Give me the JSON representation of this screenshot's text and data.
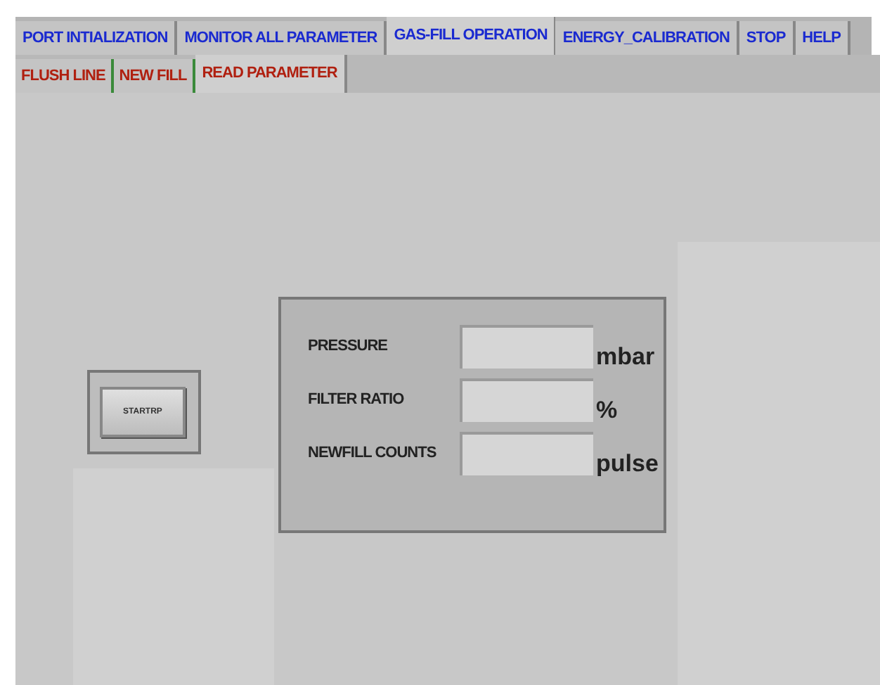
{
  "tabs": [
    {
      "label": "PORT INTIALIZATION",
      "selected": false
    },
    {
      "label": "MONITOR ALL PARAMETER",
      "selected": false
    },
    {
      "label": "GAS-FILL OPERATION",
      "selected": true
    },
    {
      "label": "ENERGY_CALIBRATION",
      "selected": false
    },
    {
      "label": "STOP",
      "selected": false
    },
    {
      "label": "HELP",
      "selected": false
    }
  ],
  "subtabs": [
    {
      "label": "FLUSH LINE",
      "selected": false
    },
    {
      "label": "NEW FILL",
      "selected": false
    },
    {
      "label": "READ PARAMETER",
      "selected": true
    }
  ],
  "start_button": {
    "label": "STARTRP"
  },
  "parameters": [
    {
      "label": "PRESSURE",
      "unit": "mbar"
    },
    {
      "label": "FILTER RATIO",
      "unit": "%"
    },
    {
      "label": "NEWFILL COUNTS",
      "unit": "pulse"
    }
  ]
}
